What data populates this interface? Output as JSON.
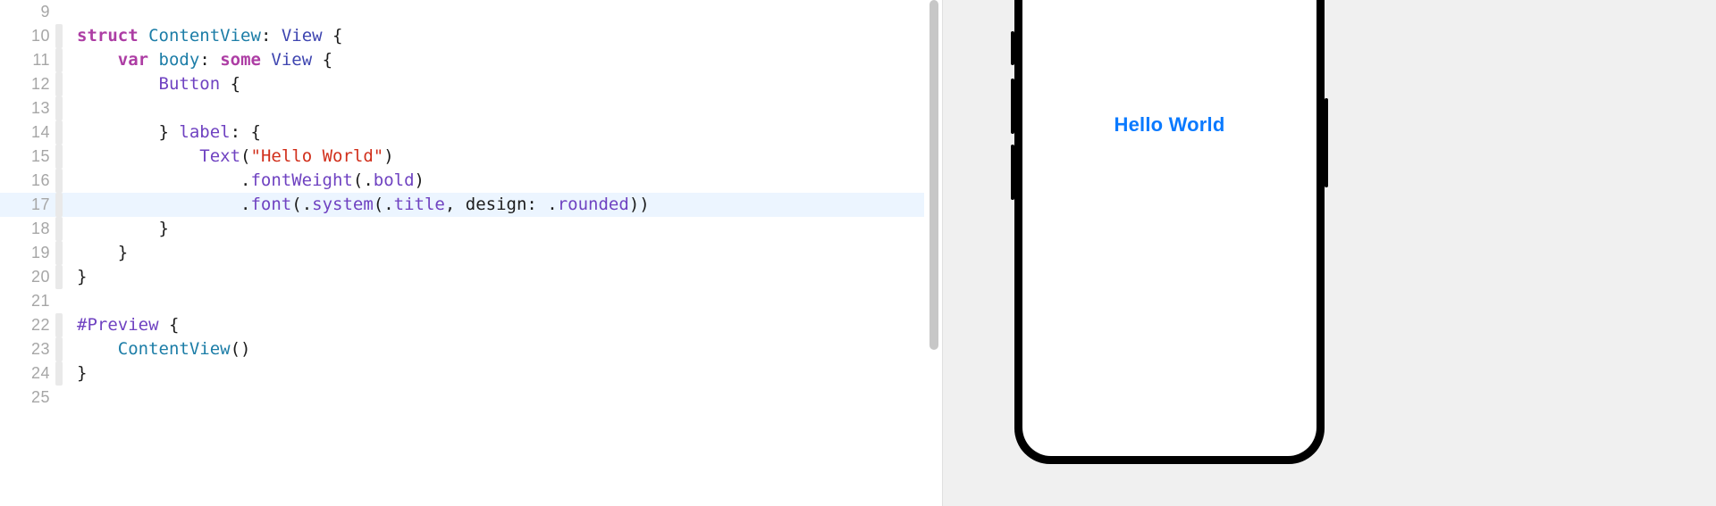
{
  "editor": {
    "highlight_line_index": 8,
    "lines": [
      {
        "num": "9",
        "fold": false,
        "seg": []
      },
      {
        "num": "10",
        "fold": true,
        "seg": [
          {
            "t": "struct",
            "c": "kw"
          },
          {
            "t": " ",
            "c": "pl"
          },
          {
            "t": "ContentView",
            "c": "decl"
          },
          {
            "t": ": ",
            "c": "pl"
          },
          {
            "t": "View",
            "c": "type"
          },
          {
            "t": " {",
            "c": "pl"
          }
        ]
      },
      {
        "num": "11",
        "fold": true,
        "seg": [
          {
            "t": "    ",
            "c": "pl"
          },
          {
            "t": "var",
            "c": "kw"
          },
          {
            "t": " ",
            "c": "pl"
          },
          {
            "t": "body",
            "c": "decl"
          },
          {
            "t": ": ",
            "c": "pl"
          },
          {
            "t": "some",
            "c": "kw"
          },
          {
            "t": " ",
            "c": "pl"
          },
          {
            "t": "View",
            "c": "type"
          },
          {
            "t": " {",
            "c": "pl"
          }
        ]
      },
      {
        "num": "12",
        "fold": true,
        "seg": [
          {
            "t": "        ",
            "c": "pl"
          },
          {
            "t": "Button",
            "c": "callsys"
          },
          {
            "t": " {",
            "c": "pl"
          }
        ]
      },
      {
        "num": "13",
        "fold": true,
        "seg": []
      },
      {
        "num": "14",
        "fold": true,
        "seg": [
          {
            "t": "        } ",
            "c": "pl"
          },
          {
            "t": "label",
            "c": "labelc"
          },
          {
            "t": ": {",
            "c": "pl"
          }
        ]
      },
      {
        "num": "15",
        "fold": true,
        "seg": [
          {
            "t": "            ",
            "c": "pl"
          },
          {
            "t": "Text",
            "c": "callsys"
          },
          {
            "t": "(",
            "c": "pl"
          },
          {
            "t": "\"Hello World\"",
            "c": "str"
          },
          {
            "t": ")",
            "c": "pl"
          }
        ]
      },
      {
        "num": "16",
        "fold": true,
        "seg": [
          {
            "t": "                ",
            "c": "pl"
          },
          {
            "t": ".",
            "c": "pl"
          },
          {
            "t": "fontWeight",
            "c": "mod"
          },
          {
            "t": "(.",
            "c": "pl"
          },
          {
            "t": "bold",
            "c": "enum"
          },
          {
            "t": ")",
            "c": "pl"
          }
        ]
      },
      {
        "num": "17",
        "fold": true,
        "seg": [
          {
            "t": "                ",
            "c": "pl"
          },
          {
            "t": ".",
            "c": "pl"
          },
          {
            "t": "font",
            "c": "mod"
          },
          {
            "t": "(.",
            "c": "pl"
          },
          {
            "t": "system",
            "c": "enum"
          },
          {
            "t": "(.",
            "c": "pl"
          },
          {
            "t": "title",
            "c": "enum"
          },
          {
            "t": ", ",
            "c": "pl"
          },
          {
            "t": "design",
            "c": "argl"
          },
          {
            "t": ": .",
            "c": "pl"
          },
          {
            "t": "rounded",
            "c": "enum"
          },
          {
            "t": "))",
            "c": "pl"
          }
        ]
      },
      {
        "num": "18",
        "fold": true,
        "seg": [
          {
            "t": "        }",
            "c": "pl"
          }
        ]
      },
      {
        "num": "19",
        "fold": true,
        "seg": [
          {
            "t": "    }",
            "c": "pl"
          }
        ]
      },
      {
        "num": "20",
        "fold": true,
        "seg": [
          {
            "t": "}",
            "c": "pl"
          }
        ]
      },
      {
        "num": "21",
        "fold": false,
        "seg": []
      },
      {
        "num": "22",
        "fold": true,
        "seg": [
          {
            "t": "#Preview",
            "c": "pre"
          },
          {
            "t": " {",
            "c": "pl"
          }
        ]
      },
      {
        "num": "23",
        "fold": true,
        "seg": [
          {
            "t": "    ",
            "c": "pl"
          },
          {
            "t": "ContentView",
            "c": "decl"
          },
          {
            "t": "()",
            "c": "pl"
          }
        ]
      },
      {
        "num": "24",
        "fold": true,
        "seg": [
          {
            "t": "}",
            "c": "pl"
          }
        ]
      },
      {
        "num": "25",
        "fold": false,
        "seg": []
      }
    ]
  },
  "preview": {
    "button_text": "Hello World",
    "button_color": "#0a7aff"
  }
}
